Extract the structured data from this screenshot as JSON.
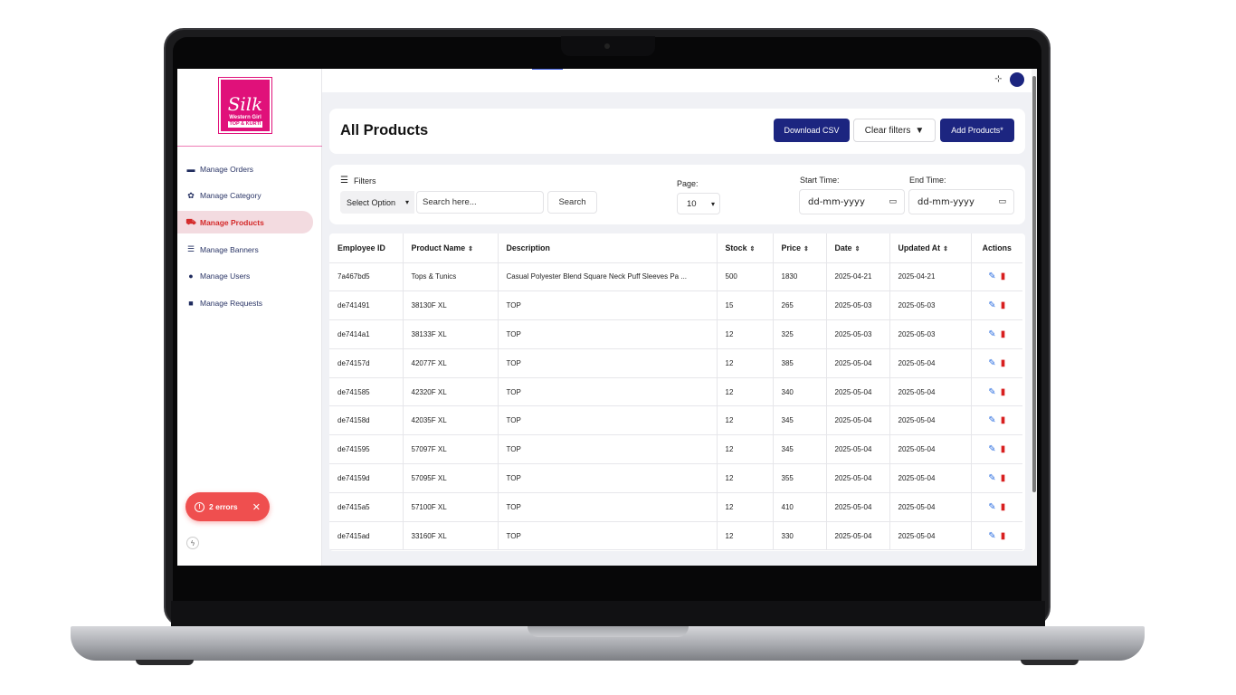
{
  "brand": {
    "logo_script": "Silk",
    "logo_line1": "Western Girl",
    "logo_line2": "TOP & KURTI"
  },
  "sidebar": {
    "items": [
      {
        "label": "Manage Orders",
        "icon": "orders-icon"
      },
      {
        "label": "Manage Category",
        "icon": "category-icon"
      },
      {
        "label": "Manage Products",
        "icon": "cart-icon",
        "active": true
      },
      {
        "label": "Manage Banners",
        "icon": "sliders-icon"
      },
      {
        "label": "Manage Users",
        "icon": "user-icon"
      },
      {
        "label": "Manage Requests",
        "icon": "lock-icon"
      }
    ]
  },
  "toast": {
    "text": "2 errors"
  },
  "header": {
    "title": "All Products",
    "download_label": "Download CSV",
    "clear_label": "Clear filters",
    "add_label": "Add Products*"
  },
  "filters": {
    "label": "Filters",
    "select_value": "Select Option",
    "search_placeholder": "Search here...",
    "search_button": "Search",
    "page_label": "Page:",
    "page_value": "10",
    "start_label": "Start Time:",
    "end_label": "End Time:",
    "start_value": "dd-mm-yyyy",
    "end_value": "dd-mm-yyyy"
  },
  "table": {
    "headers": [
      "Employee ID",
      "Product Name",
      "Description",
      "Stock",
      "Price",
      "Date",
      "Updated At",
      "Actions"
    ],
    "rows": [
      [
        "7a467bd5",
        "Tops & Tunics",
        "Casual Polyester Blend Square Neck Puff Sleeves Pa ...",
        "500",
        "1830",
        "2025-04-21",
        "2025-04-21"
      ],
      [
        "de741491",
        "38130F XL",
        "TOP",
        "15",
        "265",
        "2025-05-03",
        "2025-05-03"
      ],
      [
        "de7414a1",
        "38133F XL",
        "TOP",
        "12",
        "325",
        "2025-05-03",
        "2025-05-03"
      ],
      [
        "de74157d",
        "42077F XL",
        "TOP",
        "12",
        "385",
        "2025-05-04",
        "2025-05-04"
      ],
      [
        "de741585",
        "42320F XL",
        "TOP",
        "12",
        "340",
        "2025-05-04",
        "2025-05-04"
      ],
      [
        "de74158d",
        "42035F XL",
        "TOP",
        "12",
        "345",
        "2025-05-04",
        "2025-05-04"
      ],
      [
        "de741595",
        "57097F XL",
        "TOP",
        "12",
        "345",
        "2025-05-04",
        "2025-05-04"
      ],
      [
        "de74159d",
        "57095F XL",
        "TOP",
        "12",
        "355",
        "2025-05-04",
        "2025-05-04"
      ],
      [
        "de7415a5",
        "57100F XL",
        "TOP",
        "12",
        "410",
        "2025-05-04",
        "2025-05-04"
      ],
      [
        "de7415ad",
        "33160F XL",
        "TOP",
        "12",
        "330",
        "2025-05-04",
        "2025-05-04"
      ]
    ]
  },
  "colors": {
    "primary": "#1c2580",
    "accent": "#e0117a",
    "active_text": "#d42a2a",
    "error": "#ef4f4f"
  }
}
